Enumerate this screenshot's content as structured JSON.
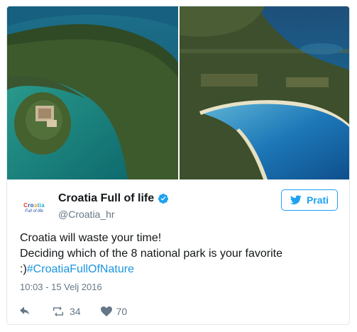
{
  "logo": {
    "line1_a": "C",
    "line1_b": "ro",
    "line1_c": "a",
    "line1_d": "tia",
    "line2": "Full of life"
  },
  "user": {
    "display_name": "Croatia Full of life",
    "handle": "@Croatia_hr"
  },
  "follow_button": {
    "label": "Prati"
  },
  "tweet": {
    "line1": "Croatia will waste your time!",
    "line2": "Deciding which of the 8 national park is your favorite",
    "line3_prefix": ":)",
    "hashtag": "#CroatiaFullOfNature",
    "timestamp": "10:03 - 15 Velj 2016"
  },
  "actions": {
    "retweets": "34",
    "likes": "70"
  },
  "colors": {
    "accent": "#1da1f2",
    "hashtag": "#1b95e0",
    "muted": "#657786",
    "like": "#657786"
  },
  "icons": [
    "reply-icon",
    "retweet-icon",
    "heart-icon",
    "twitter-bird-icon",
    "verified-badge-icon"
  ]
}
